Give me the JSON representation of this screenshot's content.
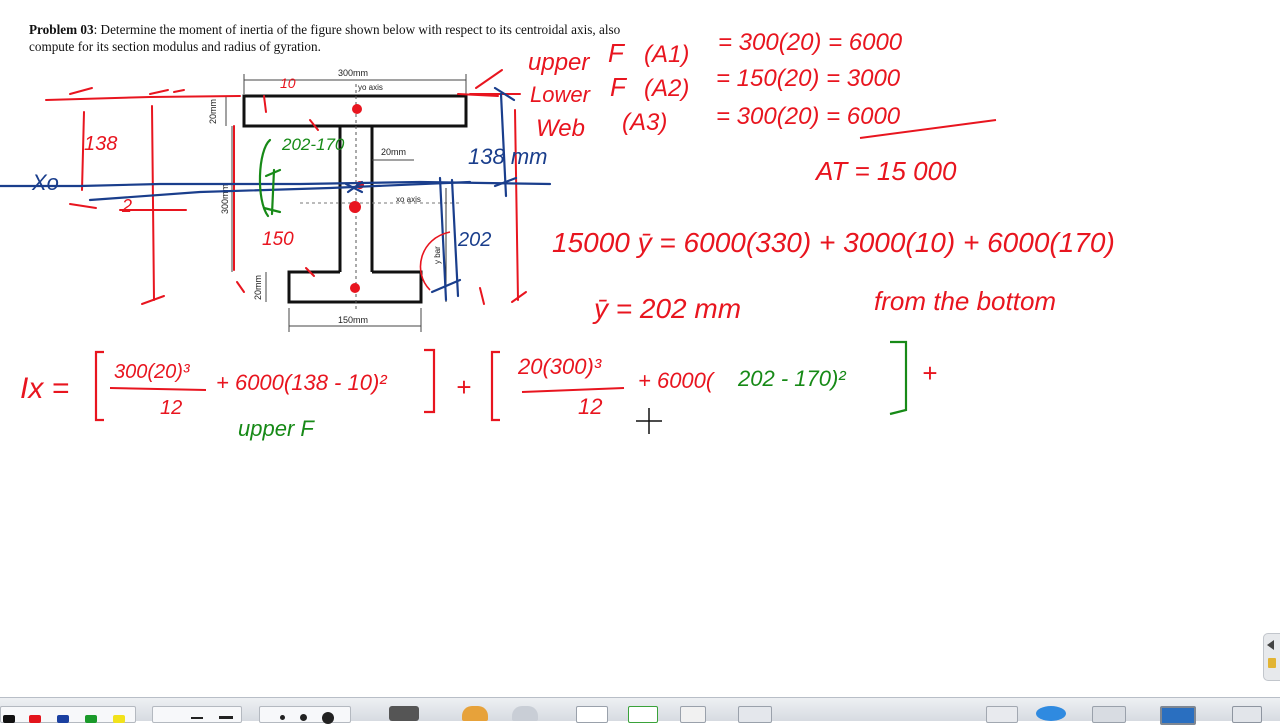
{
  "problem": {
    "label": "Problem 03",
    "text": ": Determine the moment of inertia of the figure shown below with respect to its centroidal axis, also compute for its section modulus and radius of gyration."
  },
  "figure": {
    "dim_top_width": "300mm",
    "dim_top_flange_thk": "20mm",
    "dim_web_thk": "20mm",
    "dim_height": "300mm",
    "dim_bottom_flange_thk": "20mm",
    "dim_bottom_width": "150mm",
    "yo_axis": "yo axis",
    "xo_axis": "xo axis",
    "y_bar": "y bar"
  },
  "annotations": {
    "xo": "Xo",
    "n138_left": "138",
    "n202_170": "202-170",
    "n150": "150",
    "n138mm": "138 mm",
    "n202": "202",
    "n10": "10",
    "n2": "2"
  },
  "areas": {
    "upper_label": "upper",
    "upper_f": "F",
    "upper_a": "(A1)",
    "upper_eq": "= 300(20) = 6000",
    "lower_label": "Lower",
    "lower_f": "F",
    "lower_a": "(A2)",
    "lower_eq": "= 150(20) = 3000",
    "web_label": "Web",
    "web_a": "(A3)",
    "web_eq": "= 300(20) = 6000",
    "total": "AT = 15 000"
  },
  "centroid": {
    "equation": "15000 ȳ  =  6000(330) + 3000(10) + 6000(170)",
    "result": "ȳ = 202 mm",
    "result_tail": "from the bottom"
  },
  "ix": {
    "lhs": "Ix =",
    "t1_num": "300(20)³",
    "t1_den": "12",
    "t1_rest": "+ 6000(138 - 10)²",
    "t1_label": "upper F",
    "t2_num": "20(300)³",
    "t2_den": "12",
    "t2_rest_a": "+ 6000(",
    "t2_rest_b": "202 - 170)²",
    "plus_end": "+"
  },
  "toolbar": {
    "colors": [
      "#111111",
      "#e3141c",
      "#1a3fa0",
      "#1a9a2a",
      "#f2e21b"
    ],
    "items": [
      "pen-color-black",
      "pen-color-red",
      "pen-color-blue",
      "pen-color-green",
      "pen-color-yellow",
      "line-width",
      "shape-tools",
      "keyboard",
      "undo",
      "redo",
      "blank-page",
      "insert-page",
      "delete-page",
      "screen-capture",
      "highlighter",
      "web-browser",
      "folder",
      "display",
      "settings"
    ]
  }
}
